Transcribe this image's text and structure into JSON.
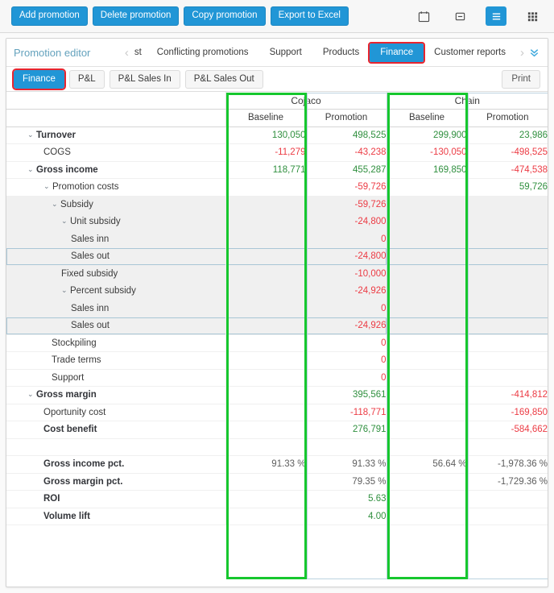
{
  "toolbar": {
    "buttons": [
      {
        "label": "Add promotion",
        "name": "add-promotion-button"
      },
      {
        "label": "Delete promotion",
        "name": "delete-promotion-button"
      },
      {
        "label": "Copy promotion",
        "name": "copy-promotion-button"
      },
      {
        "label": "Export to Excel",
        "name": "export-to-excel-button"
      }
    ],
    "icons": [
      {
        "name": "calendar-icon",
        "active": false
      },
      {
        "name": "collapse-box-icon",
        "active": false
      },
      {
        "name": "list-view-icon",
        "active": true
      },
      {
        "name": "grid-view-icon",
        "active": false
      }
    ]
  },
  "nav": {
    "editor_title": "Promotion editor",
    "prev_arrow": "‹",
    "next_arrow": "›",
    "expand_chevrons": "∨∨",
    "tabs": [
      {
        "label": "st",
        "selected": false,
        "clipped": true
      },
      {
        "label": "Conflicting promotions",
        "selected": false
      },
      {
        "label": "Support",
        "selected": false
      },
      {
        "label": "Products",
        "selected": false
      },
      {
        "label": "Finance",
        "selected": true
      },
      {
        "label": "Customer reports",
        "selected": false
      }
    ]
  },
  "subtabs": {
    "items": [
      {
        "label": "Finance",
        "selected": true
      },
      {
        "label": "P&L",
        "selected": false
      },
      {
        "label": "P&L Sales In",
        "selected": false
      },
      {
        "label": "P&L Sales Out",
        "selected": false
      }
    ],
    "print_label": "Print"
  },
  "grid": {
    "groups": [
      {
        "label": "Cojaco"
      },
      {
        "label": "Chain"
      }
    ],
    "columns": [
      {
        "label": "Baseline",
        "highlighted": true
      },
      {
        "label": "Promotion",
        "highlighted": false
      },
      {
        "label": "Baseline",
        "highlighted": true
      },
      {
        "label": "Promotion",
        "highlighted": false
      }
    ],
    "rows": [
      {
        "label": "Turnover",
        "indent": 1,
        "bold": true,
        "caret": "⌄",
        "alt": false,
        "selected": false,
        "values": [
          "130,050",
          "498,525",
          "299,900",
          "23,986"
        ],
        "signs": [
          "pos",
          "pos",
          "pos",
          "pos"
        ]
      },
      {
        "label": "COGS",
        "indent": 2,
        "bold": false,
        "caret": "",
        "alt": false,
        "selected": false,
        "values": [
          "-11,279",
          "-43,238",
          "-130,050",
          "-498,525"
        ],
        "signs": [
          "neg",
          "neg",
          "neg",
          "neg"
        ]
      },
      {
        "label": "Gross income",
        "indent": 1,
        "bold": true,
        "caret": "⌄",
        "alt": false,
        "selected": false,
        "values": [
          "118,771",
          "455,287",
          "169,850",
          "-474,538"
        ],
        "signs": [
          "pos",
          "pos",
          "pos",
          "neg"
        ]
      },
      {
        "label": "Promotion costs",
        "indent": 2,
        "bold": false,
        "caret": "⌄",
        "alt": false,
        "selected": false,
        "values": [
          "",
          "-59,726",
          "",
          "59,726"
        ],
        "signs": [
          "",
          "neg",
          "",
          "pos"
        ]
      },
      {
        "label": "Subsidy",
        "indent": 3,
        "bold": false,
        "caret": "⌄",
        "alt": true,
        "selected": false,
        "values": [
          "",
          "-59,726",
          "",
          ""
        ],
        "signs": [
          "",
          "neg",
          "",
          ""
        ]
      },
      {
        "label": "Unit subsidy",
        "indent": 4,
        "bold": false,
        "caret": "⌄",
        "alt": true,
        "selected": false,
        "values": [
          "",
          "-24,800",
          "",
          ""
        ],
        "signs": [
          "",
          "neg",
          "",
          ""
        ]
      },
      {
        "label": "Sales inn",
        "indent": 5,
        "bold": false,
        "caret": "",
        "alt": true,
        "selected": false,
        "values": [
          "",
          "0",
          "",
          ""
        ],
        "signs": [
          "",
          "neg",
          "",
          ""
        ]
      },
      {
        "label": "Sales out",
        "indent": 5,
        "bold": false,
        "caret": "",
        "alt": true,
        "selected": true,
        "values": [
          "",
          "-24,800",
          "",
          ""
        ],
        "signs": [
          "",
          "neg",
          "",
          ""
        ]
      },
      {
        "label": "Fixed subsidy",
        "indent": 4,
        "bold": false,
        "caret": "",
        "alt": true,
        "selected": false,
        "values": [
          "",
          "-10,000",
          "",
          ""
        ],
        "signs": [
          "",
          "neg",
          "",
          ""
        ]
      },
      {
        "label": "Percent subsidy",
        "indent": 4,
        "bold": false,
        "caret": "⌄",
        "alt": true,
        "selected": false,
        "values": [
          "",
          "-24,926",
          "",
          ""
        ],
        "signs": [
          "",
          "neg",
          "",
          ""
        ]
      },
      {
        "label": "Sales inn",
        "indent": 5,
        "bold": false,
        "caret": "",
        "alt": true,
        "selected": false,
        "values": [
          "",
          "0",
          "",
          ""
        ],
        "signs": [
          "",
          "neg",
          "",
          ""
        ]
      },
      {
        "label": "Sales out",
        "indent": 5,
        "bold": false,
        "caret": "",
        "alt": true,
        "selected": true,
        "values": [
          "",
          "-24,926",
          "",
          ""
        ],
        "signs": [
          "",
          "neg",
          "",
          ""
        ]
      },
      {
        "label": "Stockpiling",
        "indent": 3,
        "bold": false,
        "caret": "",
        "alt": false,
        "selected": false,
        "values": [
          "",
          "0",
          "",
          ""
        ],
        "signs": [
          "",
          "neg",
          "",
          ""
        ]
      },
      {
        "label": "Trade terms",
        "indent": 3,
        "bold": false,
        "caret": "",
        "alt": false,
        "selected": false,
        "values": [
          "",
          "0",
          "",
          ""
        ],
        "signs": [
          "",
          "neg",
          "",
          ""
        ]
      },
      {
        "label": "Support",
        "indent": 3,
        "bold": false,
        "caret": "",
        "alt": false,
        "selected": false,
        "values": [
          "",
          "0",
          "",
          ""
        ],
        "signs": [
          "",
          "neg",
          "",
          ""
        ]
      },
      {
        "label": "Gross margin",
        "indent": 1,
        "bold": true,
        "caret": "⌄",
        "alt": false,
        "selected": false,
        "values": [
          "",
          "395,561",
          "",
          "-414,812"
        ],
        "signs": [
          "",
          "pos",
          "",
          "neg"
        ]
      },
      {
        "label": "Oportunity cost",
        "indent": 2,
        "bold": false,
        "caret": "",
        "alt": false,
        "selected": false,
        "values": [
          "",
          "-118,771",
          "",
          "-169,850"
        ],
        "signs": [
          "",
          "neg",
          "",
          "neg"
        ]
      },
      {
        "label": "Cost benefit",
        "indent": 2,
        "bold": true,
        "caret": "",
        "alt": false,
        "selected": false,
        "values": [
          "",
          "276,791",
          "",
          "-584,662"
        ],
        "signs": [
          "",
          "pos",
          "",
          "neg"
        ]
      },
      {
        "label": "",
        "indent": 2,
        "bold": false,
        "caret": "",
        "alt": false,
        "selected": false,
        "spacer": true,
        "values": [
          "",
          "",
          "",
          ""
        ],
        "signs": [
          "",
          "",
          "",
          ""
        ]
      },
      {
        "label": "Gross income pct.",
        "indent": 2,
        "bold": true,
        "caret": "",
        "alt": false,
        "selected": false,
        "values": [
          "91.33 %",
          "91.33 %",
          "56.64 %",
          "-1,978.36 %"
        ],
        "signs": [
          "pct",
          "pct",
          "pct",
          "pct"
        ]
      },
      {
        "label": "Gross margin pct.",
        "indent": 2,
        "bold": true,
        "caret": "",
        "alt": false,
        "selected": false,
        "values": [
          "",
          "79.35 %",
          "",
          "-1,729.36 %"
        ],
        "signs": [
          "",
          "pct",
          "",
          "pct"
        ]
      },
      {
        "label": "ROI",
        "indent": 2,
        "bold": true,
        "caret": "",
        "alt": false,
        "selected": false,
        "values": [
          "",
          "5.63",
          "",
          ""
        ],
        "signs": [
          "",
          "pos",
          "",
          ""
        ]
      },
      {
        "label": "Volume lift",
        "indent": 2,
        "bold": true,
        "caret": "",
        "alt": false,
        "selected": false,
        "values": [
          "",
          "4.00",
          "",
          ""
        ],
        "signs": [
          "",
          "pos",
          "",
          ""
        ]
      }
    ]
  },
  "colors": {
    "accent": "#2196d6",
    "highlight_box": "#16c72e",
    "selection_outline": "#e8252f",
    "positive": "#2f8f3e",
    "negative": "#ec3b44"
  }
}
